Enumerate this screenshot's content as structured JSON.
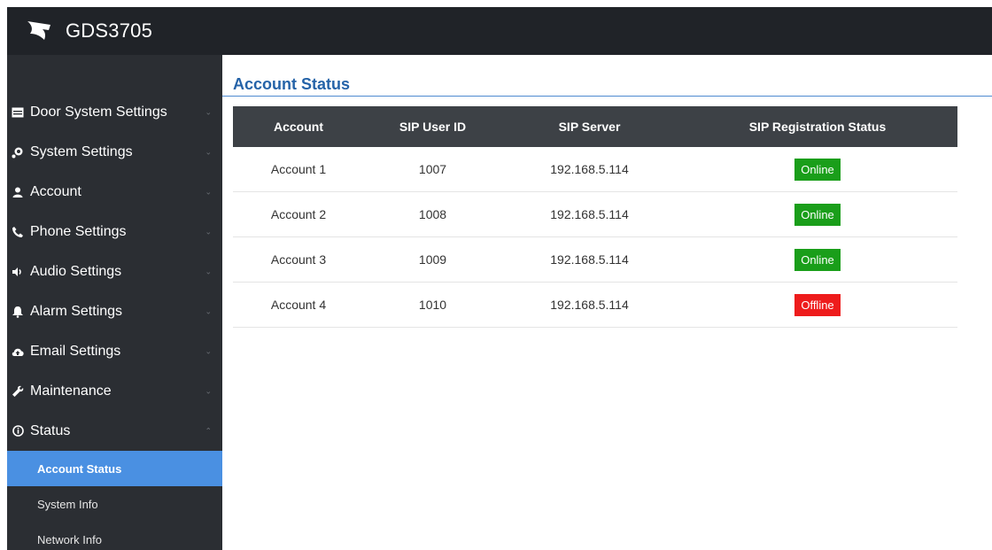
{
  "header": {
    "product_name": "GDS3705"
  },
  "sidebar": {
    "items": [
      {
        "label": "Door System Settings",
        "icon": "door-system-icon",
        "expanded": false
      },
      {
        "label": "System Settings",
        "icon": "system-settings-icon",
        "expanded": false
      },
      {
        "label": "Account",
        "icon": "user-icon",
        "expanded": false
      },
      {
        "label": "Phone Settings",
        "icon": "phone-icon",
        "expanded": false
      },
      {
        "label": "Audio Settings",
        "icon": "speaker-icon",
        "expanded": false
      },
      {
        "label": "Alarm Settings",
        "icon": "bell-icon",
        "expanded": false
      },
      {
        "label": "Email Settings",
        "icon": "cloud-upload-icon",
        "expanded": false
      },
      {
        "label": "Maintenance",
        "icon": "wrench-icon",
        "expanded": false
      },
      {
        "label": "Status",
        "icon": "info-circle-icon",
        "expanded": true
      }
    ],
    "status_subitems": [
      {
        "label": "Account Status",
        "active": true
      },
      {
        "label": "System Info",
        "active": false
      },
      {
        "label": "Network Info",
        "active": false
      }
    ]
  },
  "main": {
    "title": "Account Status",
    "table": {
      "columns": [
        "Account",
        "SIP User ID",
        "SIP Server",
        "SIP Registration Status"
      ],
      "rows": [
        {
          "account": "Account 1",
          "sip_user_id": "1007",
          "sip_server": "192.168.5.114",
          "status": "Online"
        },
        {
          "account": "Account 2",
          "sip_user_id": "1008",
          "sip_server": "192.168.5.114",
          "status": "Online"
        },
        {
          "account": "Account 3",
          "sip_user_id": "1009",
          "sip_server": "192.168.5.114",
          "status": "Online"
        },
        {
          "account": "Account 4",
          "sip_user_id": "1010",
          "sip_server": "192.168.5.114",
          "status": "Offline"
        }
      ]
    }
  },
  "colors": {
    "topbar": "#202328",
    "sidebar": "#2b2e33",
    "active_item": "#4a90e2",
    "title": "#2563a8",
    "table_header": "#3d4146",
    "status_online": "#1a9e1a",
    "status_offline": "#ee1c1c"
  }
}
